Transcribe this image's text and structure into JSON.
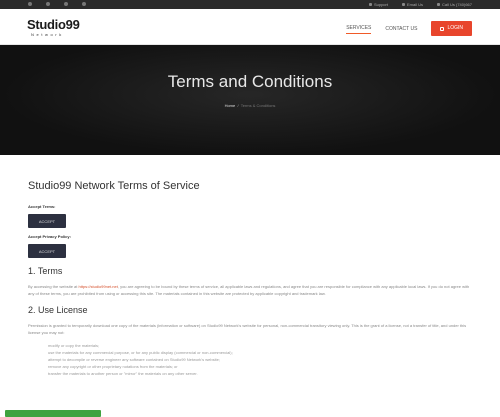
{
  "topbar": {
    "social_icons": [
      "facebook-icon",
      "twitter-icon",
      "google-plus-icon",
      "linkedin-icon"
    ],
    "links": [
      {
        "icon": "support-icon",
        "label": "Support"
      },
      {
        "icon": "email-icon",
        "label": "Email Us"
      },
      {
        "icon": "phone-icon",
        "label": "Call Us (740)667"
      }
    ]
  },
  "logo": {
    "main": "Studio99",
    "sub": "Network"
  },
  "nav": {
    "items": [
      {
        "label": "SERVICES",
        "active": true
      },
      {
        "label": "CONTACT US",
        "active": false
      }
    ],
    "login_label": "LOGIN"
  },
  "hero": {
    "title": "Terms and Conditions",
    "breadcrumb_home": "Home",
    "breadcrumb_current": "Terms & Conditions"
  },
  "content": {
    "title": "Studio99 Network Terms of Service",
    "accept_terms_label": "Accept Terms:",
    "accept_terms_button": "ACCEPT",
    "accept_privacy_label": "Accept Privacy Policy:",
    "accept_privacy_button": "ACCEPT",
    "sections": [
      {
        "heading": "1. Terms",
        "para_before_link": "By accessing the website at ",
        "link": "https://studio99net.net",
        "para_after_link": ", you are agreeing to be bound by these terms of service, all applicable laws and regulations, and agree that you are responsible for compliance with any applicable local laws. If you do not agree with any of these terms, you are prohibited from using or accessing this site. The materials contained in this website are protected by applicable copyright and trademark law."
      },
      {
        "heading": "2. Use License",
        "para": "Permission is granted to temporarily download one copy of the materials (information or software) on Studio99 Network's website for personal, non-commercial transitory viewing only. This is the grant of a license, not a transfer of title, and under this license you may not:",
        "items": [
          "modify or copy the materials;",
          "use the materials for any commercial purpose, or for any public display (commercial or non-commercial);",
          "attempt to decompile or reverse engineer any software contained on Studio99 Network's website;",
          "remove any copyright or other proprietary notations from the materials; or",
          "transfer the materials to another person or \"mirror\" the materials on any other server."
        ]
      }
    ]
  },
  "colors": {
    "accent": "#e8452c",
    "hero_bg": "#111111",
    "button_dark": "#2c3040",
    "status_bar": "#3fa33f"
  }
}
